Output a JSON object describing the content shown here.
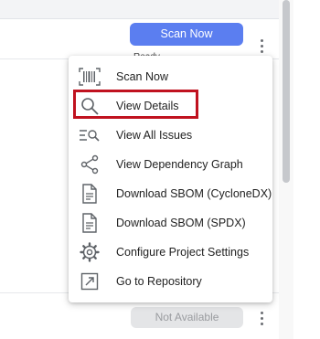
{
  "background_row": {
    "scan_button_label": "Scan Now",
    "status_text": "Ready",
    "not_available_label": "Not Available"
  },
  "context_menu": {
    "items": [
      {
        "label": "Scan Now",
        "icon": "barcode-scan-icon"
      },
      {
        "label": "View Details",
        "icon": "magnify-icon"
      },
      {
        "label": "View All Issues",
        "icon": "list-search-icon"
      },
      {
        "label": "View Dependency Graph",
        "icon": "share-graph-icon"
      },
      {
        "label": "Download SBOM (CycloneDX)",
        "icon": "document-icon"
      },
      {
        "label": "Download SBOM (SPDX)",
        "icon": "document-icon"
      },
      {
        "label": "Configure Project Settings",
        "icon": "gear-icon"
      },
      {
        "label": "Go to Repository",
        "icon": "external-link-icon"
      }
    ],
    "highlighted_item": "View Details"
  },
  "colors": {
    "primary_button": "#5b7ef0",
    "highlight_border": "#c0121f",
    "disabled_button": "#e4e5e7",
    "icon": "#5f6368"
  }
}
